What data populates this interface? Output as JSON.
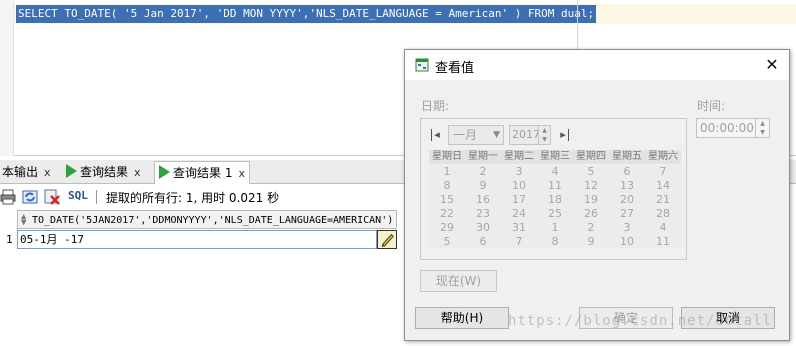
{
  "editor": {
    "sql": "SELECT TO_DATE( '5 Jan 2017', 'DD MON YYYY','NLS_DATE_LANGUAGE = American' ) FROM dual;"
  },
  "results": {
    "tabs": [
      {
        "label": "本输出",
        "close": "x"
      },
      {
        "label": "查询结果",
        "close": "x"
      },
      {
        "label": "查询结果 1",
        "close": "x"
      }
    ],
    "toolbar": {
      "sql_label": "SQL",
      "status": "提取的所有行: 1, 用时 0.021 秒"
    },
    "grid": {
      "column_header": "TO_DATE('5JAN2017','DDMONYYYY','NLS_DATE_LANGUAGE=AMERICAN')",
      "rows": [
        {
          "num": "1",
          "value": "05-1月 -17"
        }
      ]
    }
  },
  "dialog": {
    "title": "查看值",
    "close": "✕",
    "date_label": "日期:",
    "time_label": "时间:",
    "month": "一月",
    "year": "2017",
    "time_value": "00:00:00",
    "weekdays": [
      "星期日",
      "星期一",
      "星期二",
      "星期三",
      "星期四",
      "星期五",
      "星期六"
    ],
    "day_rows": [
      [
        "1",
        "2",
        "3",
        "4",
        "5",
        "6",
        "7"
      ],
      [
        "8",
        "9",
        "10",
        "11",
        "12",
        "13",
        "14"
      ],
      [
        "15",
        "16",
        "17",
        "18",
        "19",
        "20",
        "21"
      ],
      [
        "22",
        "23",
        "24",
        "25",
        "26",
        "27",
        "28"
      ],
      [
        "29",
        "30",
        "31",
        "1",
        "2",
        "3",
        "4"
      ],
      [
        "5",
        "6",
        "7",
        "8",
        "9",
        "10",
        "11"
      ]
    ],
    "buttons": {
      "now": "现在(W)",
      "help": "帮助(H)",
      "ok": "确定",
      "cancel": "取消"
    }
  },
  "watermark": "https://blog.csdn.net/dotall",
  "colors": {
    "selection": "#3c6fb3",
    "run_icon": "#2fa33d"
  }
}
